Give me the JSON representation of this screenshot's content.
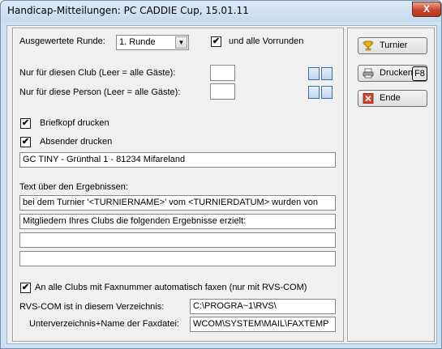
{
  "window": {
    "title": "Handicap-Mitteilungen: PC CADDIE Cup, 15.01.11",
    "close_glyph": "X"
  },
  "form": {
    "runde_label": "Ausgewertete Runde:",
    "runde_value": "1. Runde",
    "vorrunden_label": "und alle Vorrunden",
    "vorrunden_checked": "✔",
    "club_label": "Nur für diesen Club (Leer = alle Gäste):",
    "club_value": "",
    "person_label": "Nur für diese Person (Leer = alle Gäste):",
    "person_value": "",
    "briefkopf_label": "Briefkopf drucken",
    "briefkopf_checked": "✔",
    "absender_label": "Absender drucken",
    "absender_checked": "✔",
    "absender_value": "GC TINY - Grünthal 1 - 81234 Mifareland",
    "text_label": "Text über den Ergebnissen:",
    "text_lines": [
      "bei dem Turnier '<TURNIERNAME>' vom <TURNIERDATUM> wurden von",
      "Mitgliedern Ihres Clubs die folgenden Ergebnisse erzielt:",
      "",
      ""
    ],
    "fax_label": "An alle Clubs mit Faxnummer automatisch faxen (nur mit RVS-COM)",
    "fax_checked": "✔",
    "rvs_label": "RVS-COM ist in diesem Verzeichnis:",
    "rvs_value": "C:\\PROGRA~1\\RVS\\",
    "unterv_label": "Unterverzeichnis+Name der Faxdatei:",
    "unterv_value": "WCOM\\SYSTEM\\MAIL\\FAXTEMP"
  },
  "buttons": {
    "turnier": "Turnier",
    "drucken": "Drucken",
    "drucken_key": "F8",
    "ende": "Ende"
  }
}
